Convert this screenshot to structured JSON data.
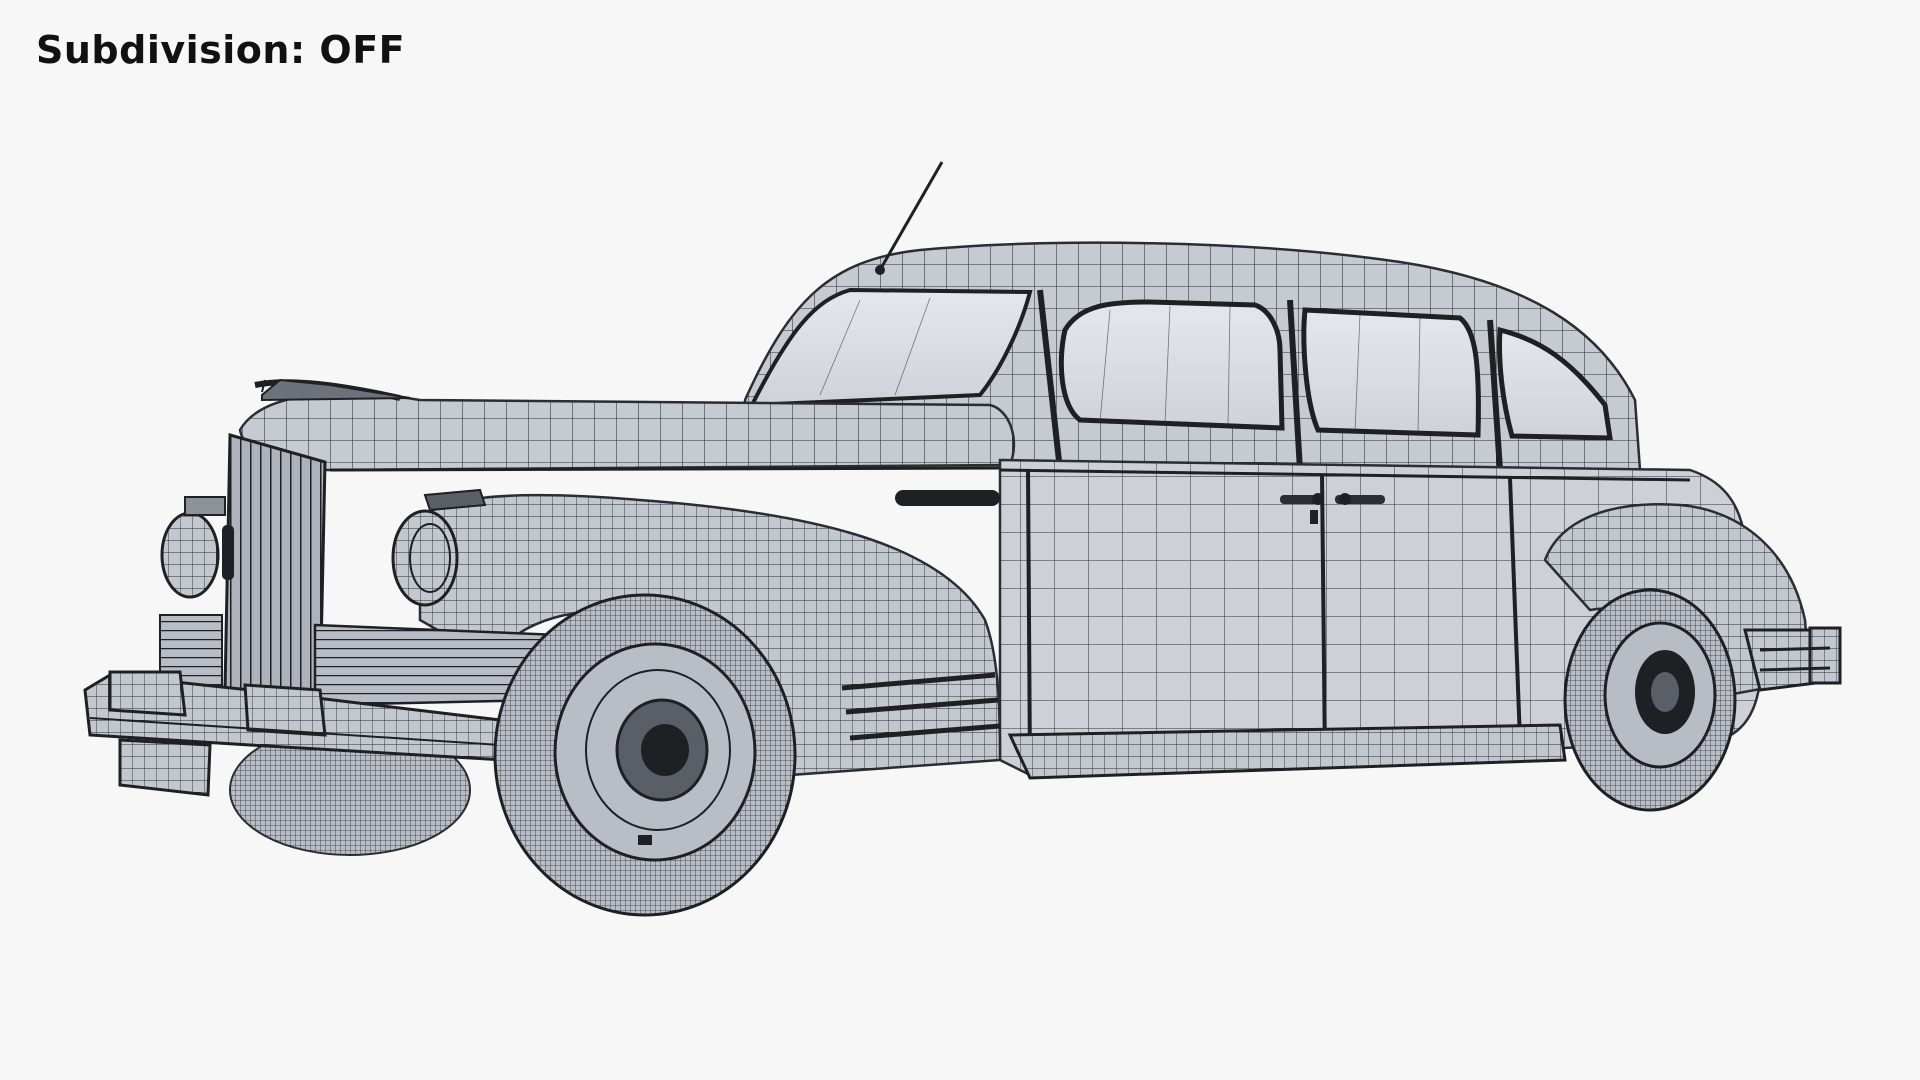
{
  "overlay": {
    "label_name": "Subdivision",
    "label_sep": ": ",
    "label_state": "OFF"
  },
  "viewport": {
    "subject": "wireframe-car",
    "background_color": "#f7f7f7",
    "mesh_fill_color": "#c8ccd2",
    "wire_color": "#2a2d33",
    "glass_color": "#d9dde2"
  }
}
